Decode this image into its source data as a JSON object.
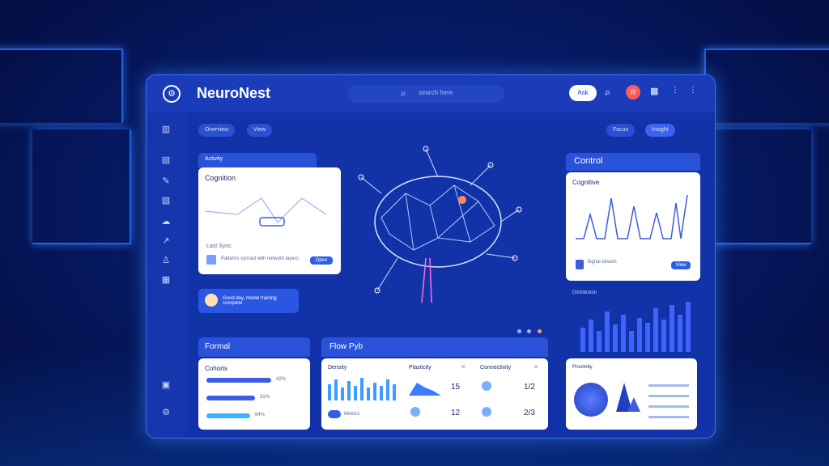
{
  "app": {
    "name": "NeuroNest"
  },
  "header": {
    "search_placeholder": "search here",
    "action_label": "Ask",
    "avatar_initial": "R"
  },
  "toolbar": {
    "chips": [
      "Overview",
      "View"
    ],
    "right_chip": "Focus",
    "right_chip2": "Insight"
  },
  "cards": {
    "activity": {
      "tab": "Activity",
      "title": "Cognition",
      "footer_label": "Last Sync",
      "desc": "Patterns synced with network layers",
      "button": "Open"
    },
    "notice": {
      "text": "Good day, model training complete"
    },
    "control": {
      "tab": "Control",
      "title": "Cognitive",
      "legend_label": "Signal stream",
      "button": "View"
    },
    "distribution": {
      "label": "Distribution"
    },
    "formal": {
      "tab": "Formal",
      "title": "Cohorts",
      "bars": [
        "42%",
        "31%",
        "64%"
      ]
    },
    "flow": {
      "tab": "Flow Pyb",
      "col1": "Density",
      "col2": "Plasticity",
      "col3": "Connectivity",
      "v1": "15",
      "v2": "12",
      "v3": "1/2",
      "v4": "2/3",
      "foot": "Metrics"
    },
    "proximity": {
      "title": "Proximity"
    }
  },
  "colors": {
    "accent": "#2f5ee6",
    "panel": "#ffffff",
    "frame": "#1233a8"
  }
}
